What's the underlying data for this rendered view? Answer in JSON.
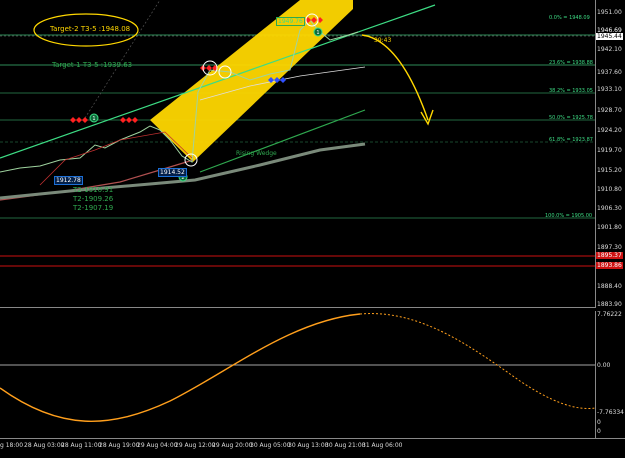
{
  "colors": {
    "background": "#000000",
    "channel_fill": "#ffd700",
    "fib_line": "#2e8b57",
    "trend_line": "#3ddc84",
    "wedge_line": "#2fa84f",
    "ma_line": "#7a8a7a",
    "price_down_line": "#b05050",
    "level_red": "#cc1111",
    "oscillator": "#ff9f1c",
    "forecast_arrow": "#ffd700",
    "bear_marker": "#ff2020",
    "bull_marker": "#3050ff",
    "badge_fill": "#0d6b3a",
    "label_box": "#1c6fd6",
    "ellipse": "#ffd700"
  },
  "chart": {
    "targets": {
      "target2": "Target-2 T3-5 :1948.08",
      "target1": "Target-1 T3-5 :1939.63"
    },
    "t2_labels": [
      "T2-1910.91",
      "T2-1909.26",
      "T2-1907.19"
    ],
    "wedge_label": "Rising Wedge",
    "countdown": "39:43",
    "price_boxes": {
      "low_left": "1912.78",
      "low_mid": "1914.52",
      "high_top": "1949.76"
    },
    "badges": [
      "1",
      "2",
      "1"
    ],
    "fib_labels": {
      "f0": "0.0% = 1948.09",
      "f23": "23.6% = 1938.88",
      "f38": "38.2% = 1933.05",
      "f50": "50.0% = 1925.78",
      "f61": "61.8% = 1923.87",
      "f100": "100.0% = 1905.00"
    }
  },
  "price_axis": {
    "ticks": [
      "1951.00",
      "1942.10",
      "1937.60",
      "1933.10",
      "1928.70",
      "1924.20",
      "1919.70",
      "1915.20",
      "1910.80",
      "1906.30",
      "1901.80",
      "1897.30",
      "1892.80",
      "1888.40",
      "1883.90"
    ],
    "current_price": "1945.44",
    "current_price_upper": "1946.69",
    "red_level_1": "1895.37",
    "red_level_2": "1893.86"
  },
  "osc_axis": {
    "top": "7.76222",
    "mid": "0.00",
    "bottom": "-7.76334",
    "zero_a": "0",
    "zero_b": "0"
  },
  "time_axis": {
    "labels": [
      "28 Aug 03:00",
      "28 Aug 11:00",
      "28 Aug 19:00",
      "29 Aug 04:00",
      "29 Aug 12:00",
      "29 Aug 20:00",
      "30 Aug 05:00",
      "30 Aug 13:00",
      "30 Aug 21:00",
      "31 Aug 06:00"
    ],
    "cut_label": "g 18:00"
  }
}
